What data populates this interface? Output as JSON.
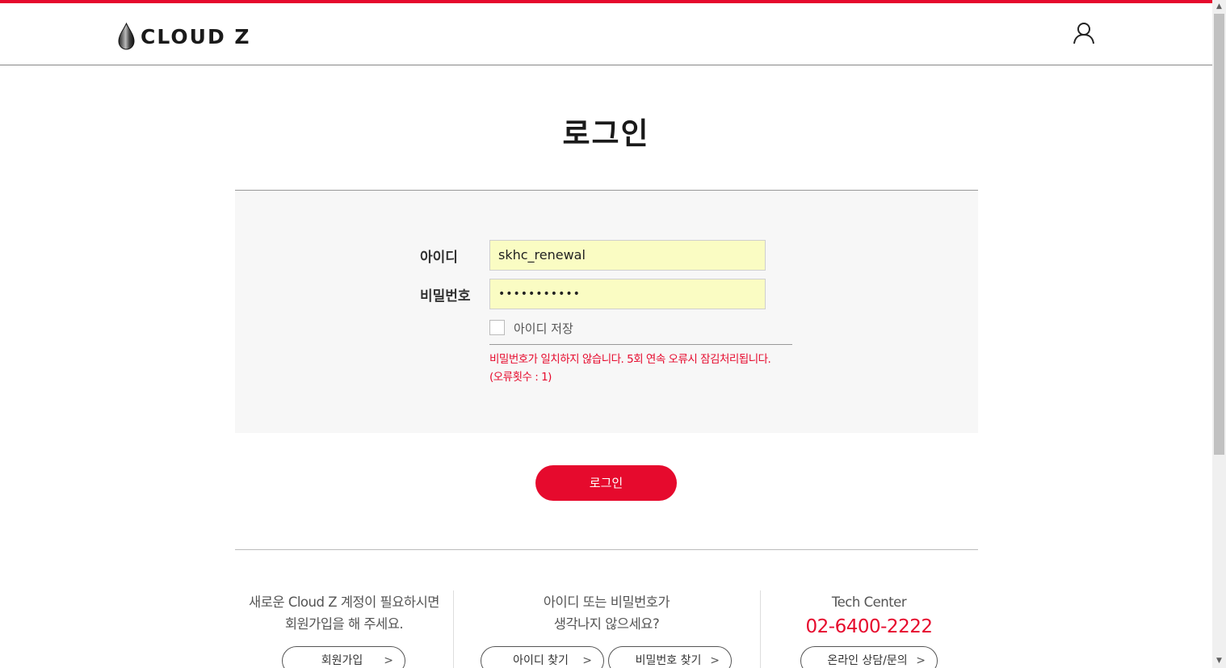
{
  "brand": {
    "logo_text": "CLOUD Z",
    "accent": "#e60a2d"
  },
  "page": {
    "title": "로그인"
  },
  "form": {
    "id_label": "아이디",
    "id_value": "skhc_renewal",
    "pw_label": "비밀번호",
    "pw_value": "•••••••••••",
    "save_id_label": "아이디 저장",
    "error_line1": "비밀번호가 일치하지 않습니다. 5회 연속 오류시 잠김처리됩니다.",
    "error_line2": "(오류횟수 : 1)"
  },
  "login_button": "로그인",
  "signup": {
    "line1": "새로운 Cloud Z 계정이 필요하시면",
    "line2": "회원가입을 해 주세요.",
    "button": "회원가입"
  },
  "find": {
    "line1": "아이디 또는 비밀번호가",
    "line2": "생각나지 않으세요?",
    "find_id_button": "아이디 찾기",
    "find_pw_button": "비밀번호 찾기"
  },
  "tech": {
    "title": "Tech Center",
    "phone": "02-6400-2222",
    "button": "온라인 상담/문의"
  }
}
